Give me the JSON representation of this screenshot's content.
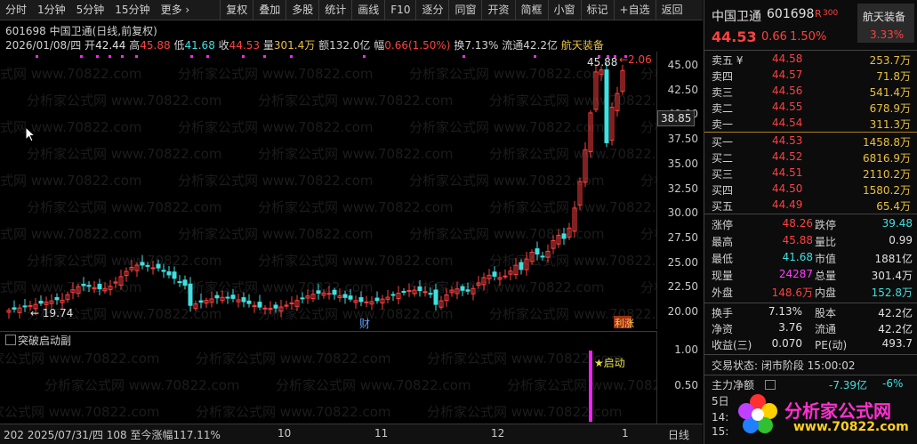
{
  "toolbar": {
    "items": [
      "分时",
      "1分钟",
      "5分钟",
      "15分钟",
      "更多 ›",
      "复权",
      "叠加",
      "多股",
      "统计",
      "画线",
      "F10",
      "逐分",
      "同窗",
      "开资",
      "简框",
      "小窗",
      "标记",
      "+自选",
      "返回"
    ]
  },
  "info": {
    "header": "601698 中国卫通(日线,前复权)",
    "date": "2026/01/08/四",
    "open_label": "开",
    "open": "42.44",
    "high_label": "高",
    "high": "45.88",
    "low_label": "低",
    "low": "41.68",
    "close_label": "收",
    "close": "44.53",
    "volume_label": "量",
    "volume": "301.4万",
    "amount_label": "额",
    "amount": "132.0亿",
    "amp_label": "幅",
    "amp": "0.66(1.50%)",
    "turnover_label": "换",
    "turnover": "7.13%",
    "float_label": "流通",
    "float": "42.2亿",
    "concept": "航天装备"
  },
  "chart": {
    "yticks": [
      "45.00",
      "42.50",
      "40.00",
      "37.50",
      "35.00",
      "32.50",
      "30.00",
      "27.50",
      "25.00",
      "22.50",
      "20.00"
    ],
    "current_price": "38.85",
    "max_label": "45.88",
    "min_label": "← 19.74",
    "event_cai": "财",
    "event_zhang": "涨",
    "event_zhang_prefix": "利",
    "max_right": "←2.06"
  },
  "sub": {
    "title": "突破启动副",
    "yticks": [
      "1.00",
      "0.50"
    ],
    "signal_label": "★启动"
  },
  "bottom": {
    "status": "202 2025/07/31/四  108  至今涨幅117.11%",
    "months": [
      "10",
      "11",
      "12",
      "1"
    ],
    "period": "日线"
  },
  "panel": {
    "name": "中国卫通",
    "code": "601698",
    "r_badge": "R",
    "r_num": "300",
    "concept": "航天装备",
    "price": "44.53",
    "change": "0.66",
    "change_pct": "1.50%",
    "concept_pct": "3.33%",
    "asks": [
      {
        "label": "卖五 ¥",
        "price": "44.58",
        "vol": "253.7万"
      },
      {
        "label": "卖四",
        "price": "44.57",
        "vol": "71.8万"
      },
      {
        "label": "卖三",
        "price": "44.56",
        "vol": "541.4万"
      },
      {
        "label": "卖二",
        "price": "44.55",
        "vol": "678.9万"
      },
      {
        "label": "卖一",
        "price": "44.54",
        "vol": "311.3万"
      }
    ],
    "bids": [
      {
        "label": "买一",
        "price": "44.53",
        "vol": "1458.8万"
      },
      {
        "label": "买二",
        "price": "44.52",
        "vol": "6816.9万"
      },
      {
        "label": "买三",
        "price": "44.51",
        "vol": "2110.2万"
      },
      {
        "label": "买四",
        "price": "44.50",
        "vol": "1580.2万"
      },
      {
        "label": "买五",
        "price": "44.49",
        "vol": "65.4万"
      }
    ],
    "stats": [
      {
        "l1": "涨停",
        "v1": "48.26",
        "l2": "跌停",
        "v2": "39.48"
      },
      {
        "l1": "最高",
        "v1": "45.88",
        "l2": "量比",
        "v2": "0.99"
      },
      {
        "l1": "最低",
        "v1": "41.68",
        "l2": "市值",
        "v2": "1881亿"
      },
      {
        "l1": "现量",
        "v1": "24287",
        "l2": "总量",
        "v2": "301.4万"
      },
      {
        "l1": "外盘",
        "v1": "148.6万",
        "l2": "内盘",
        "v2": "152.8万"
      }
    ],
    "stats2": [
      {
        "l1": "换手",
        "v1": "7.13%",
        "l2": "股本",
        "v2": "42.2亿"
      },
      {
        "l1": "净资",
        "v1": "3.76",
        "l2": "流通",
        "v2": "42.2亿"
      },
      {
        "l1": "收益(三)",
        "v1": "0.070",
        "l2": "PE(动)",
        "v2": "493.7"
      }
    ],
    "trade_status": "交易状态: 闭市阶段 15:00:02",
    "main_flow_label": "主力净额",
    "main_flow": "-7.39亿",
    "main_flow_pct": "-6%",
    "day5": "5日",
    "time_frag": "14:",
    "time_frag2": "15:"
  },
  "watermark": {
    "text": "分析家公式网 www.70822.com",
    "logo_text": "分析家公式网",
    "logo_url": "www.70822.com"
  },
  "colors": {
    "up": "#ff4040",
    "down": "#40e0e0",
    "yellow": "#e8c040",
    "magenta": "#ff20ff"
  }
}
